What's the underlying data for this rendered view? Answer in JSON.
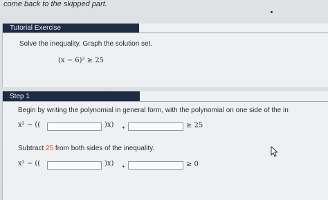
{
  "top_note": "come back to the skipped part.",
  "tutorial": {
    "header": "Tutorial Exercise",
    "instruction": "Solve the inequality. Graph the solution set.",
    "inequality": "(x − 6)² ≥ 25"
  },
  "step": {
    "header": "Step 1",
    "intro": "Begin by writing the polynomial in general form, with the polynomial on one side of the in",
    "row1": {
      "prefix": "x² − ((",
      "mid": ")x)",
      "plus": "+",
      "suffix": "≥ 25"
    },
    "subtract": {
      "before": "Subtract ",
      "value": "25",
      "after": " from both sides of the inequality."
    },
    "row2": {
      "prefix": "x² − ((",
      "mid": ")x)",
      "plus": "+",
      "suffix": "≥ 0"
    }
  },
  "colors": {
    "header_bg": "#1e2b45",
    "accent": "#e0572b"
  }
}
